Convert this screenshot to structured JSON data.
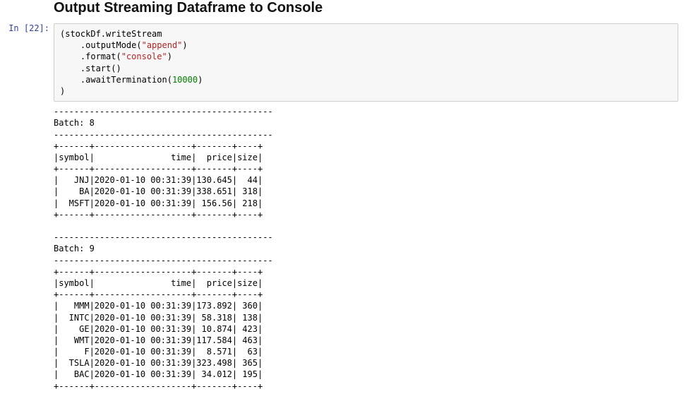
{
  "heading": "Output Streaming Dataframe to Console",
  "prompt": "In [22]:",
  "code": {
    "l1a": "(stockDf",
    "l1b": ".writeStream",
    "l2a": "    .outputMode(",
    "l2s": "\"append\"",
    "l2b": ")",
    "l3a": "    .format(",
    "l3s": "\"console\"",
    "l3b": ")",
    "l4": "    .start()",
    "l5a": "    .awaitTermination(",
    "l5n": "10000",
    "l5b": ")",
    "l6": ")"
  },
  "batches": [
    {
      "label": "Batch: 8",
      "headers": [
        "symbol",
        "time",
        "price",
        "size"
      ],
      "rows": [
        {
          "symbol": "JNJ",
          "time": "2020-01-10 00:31:39",
          "price": "130.645",
          "size": "44"
        },
        {
          "symbol": "BA",
          "time": "2020-01-10 00:31:39",
          "price": "338.651",
          "size": "318"
        },
        {
          "symbol": "MSFT",
          "time": "2020-01-10 00:31:39",
          "price": " 156.56",
          "size": "218"
        }
      ]
    },
    {
      "label": "Batch: 9",
      "headers": [
        "symbol",
        "time",
        "price",
        "size"
      ],
      "rows": [
        {
          "symbol": "MMM",
          "time": "2020-01-10 00:31:39",
          "price": "173.892",
          "size": "360"
        },
        {
          "symbol": "INTC",
          "time": "2020-01-10 00:31:39",
          "price": " 58.318",
          "size": "138"
        },
        {
          "symbol": "GE",
          "time": "2020-01-10 00:31:39",
          "price": " 10.874",
          "size": "423"
        },
        {
          "symbol": "WMT",
          "time": "2020-01-10 00:31:39",
          "price": "117.584",
          "size": "463"
        },
        {
          "symbol": "F",
          "time": "2020-01-10 00:31:39",
          "price": "  8.571",
          "size": "63"
        },
        {
          "symbol": "TSLA",
          "time": "2020-01-10 00:31:39",
          "price": "323.498",
          "size": "365"
        },
        {
          "symbol": "BAC",
          "time": "2020-01-10 00:31:39",
          "price": " 34.012",
          "size": "195"
        }
      ]
    }
  ],
  "widths": {
    "symbol": 6,
    "time": 19,
    "price": 7,
    "size": 4
  }
}
